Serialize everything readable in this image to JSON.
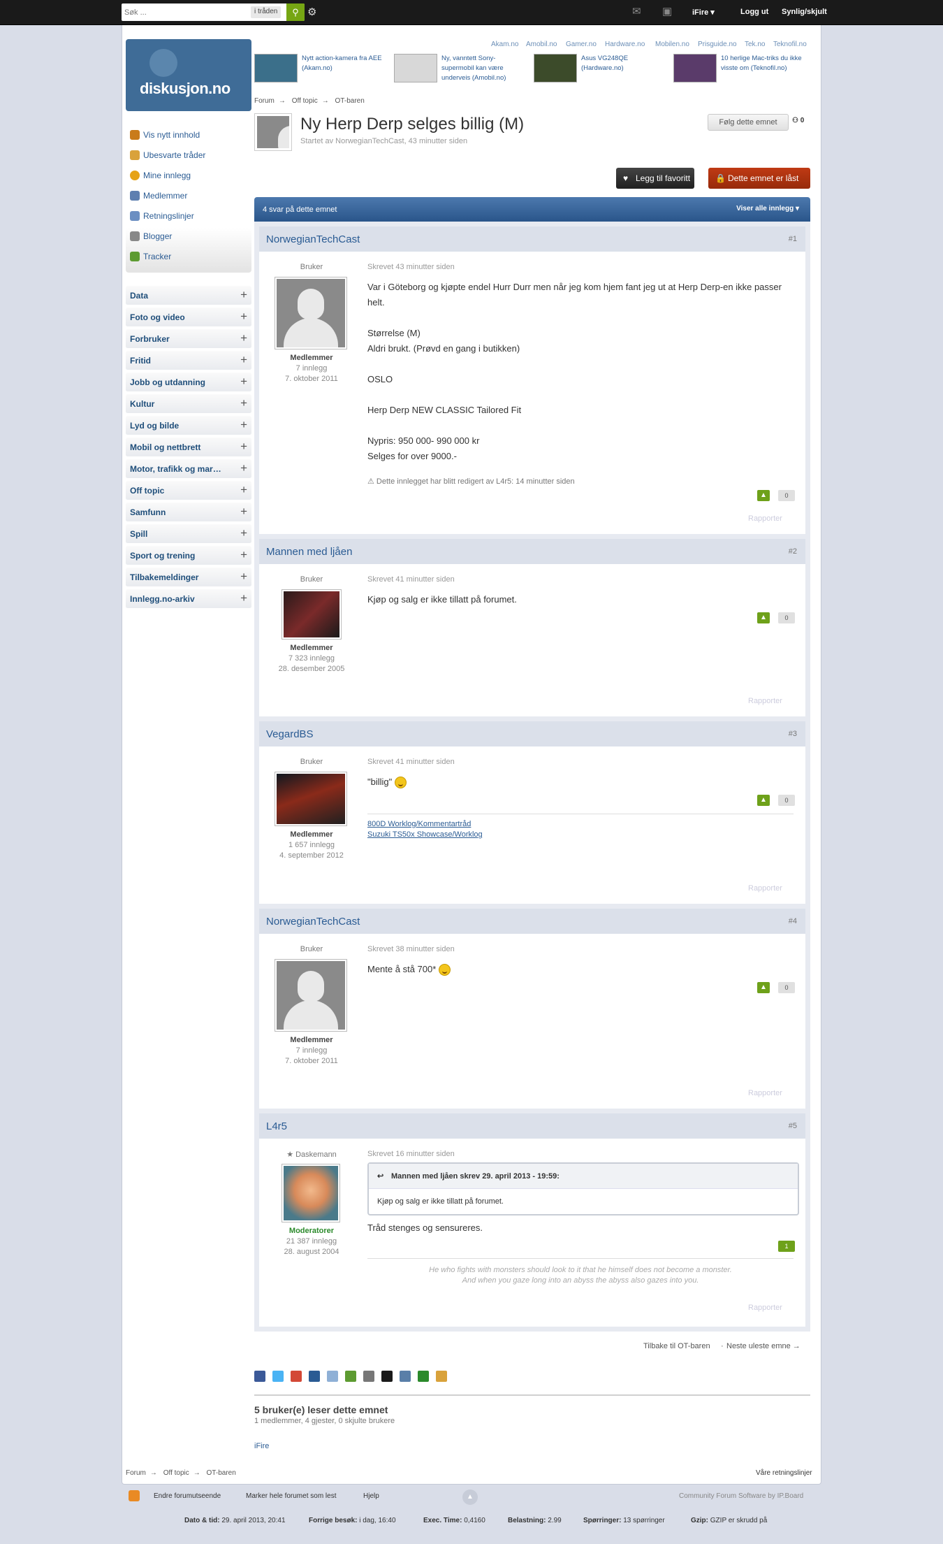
{
  "topbar": {
    "search_placeholder": "Søk ...",
    "search_scope": "i tråden",
    "user": "iFire",
    "logout": "Logg ut",
    "toggle": "Synlig/skjult"
  },
  "logo": {
    "text": "diskusjon.no"
  },
  "quicknav": [
    {
      "label": "Vis nytt innhold",
      "color": "#c97b1a"
    },
    {
      "label": "Ubesvarte tråder",
      "color": "#d9a23b"
    },
    {
      "label": "Mine innlegg",
      "color": "#e6a317"
    },
    {
      "label": "Medlemmer",
      "color": "#5e7fb0"
    },
    {
      "label": "Retningslinjer",
      "color": "#6c8fc2"
    },
    {
      "label": "Blogger",
      "color": "#888888"
    },
    {
      "label": "Tracker",
      "color": "#5d9b31"
    }
  ],
  "categories": [
    "Data",
    "Foto og video",
    "Forbruker",
    "Fritid",
    "Jobb og utdanning",
    "Kultur",
    "Lyd og bilde",
    "Mobil og nettbrett",
    "Motor, trafikk og mar…",
    "Off topic",
    "Samfunn",
    "Spill",
    "Sport og trening",
    "Tilbakemeldinger",
    "Innlegg.no-arkiv"
  ],
  "sites": [
    "Akam.no",
    "Amobil.no",
    "Gamer.no",
    "Hardware.no",
    "Mobilen.no",
    "Prisguide.no",
    "Tek.no",
    "Teknofil.no"
  ],
  "ads": [
    {
      "text": "Nytt action-kamera fra AEE (Akam.no)",
      "color": "#3b6f8a"
    },
    {
      "text": "Ny, vanntett Sony-supermobil kan være underveis (Amobil.no)",
      "color": "#d8d8d8"
    },
    {
      "text": "Asus VG248QE (Hardware.no)",
      "color": "#3c4b2a"
    },
    {
      "text": "10 herlige Mac-triks du ikke visste om (Teknofil.no)",
      "color": "#5a3b6a"
    }
  ],
  "breadcrumb": [
    "Forum",
    "Off topic",
    "OT-baren"
  ],
  "topic": {
    "title": "Ny Herp Derp selges billig (M)",
    "starter": "Startet av NorwegianTechCast, 43 minutter siden",
    "follow": "Følg dette emnet",
    "follow_count": "0",
    "favorite": "Legg til favoritt",
    "locked": "Dette emnet er låst",
    "replies": "4 svar på dette emnet",
    "show_all": "Viser alle innlegg"
  },
  "posts": [
    {
      "author": "NorwegianTechCast",
      "num": "#1",
      "title": "Bruker",
      "group": "Medlemmer",
      "posts_count": "7 innlegg",
      "joined": "7. oktober 2011",
      "date": "Skrevet 43 minutter siden",
      "body": [
        "Var i Göteborg og kjøpte endel Hurr Durr men når jeg kom hjem fant jeg ut at Herp Derp-en ikke passer helt.",
        "",
        "Størrelse (M)",
        "Aldri brukt. (Prøvd en gang i butikken)",
        "",
        "OSLO",
        "",
        "Herp Derp NEW CLASSIC Tailored Fit",
        "",
        "Nypris: 950 000- 990 000 kr",
        "Selges for over 9000.-"
      ],
      "edited": "Dette innlegget har blitt redigert av L4r5: 14 minutter siden",
      "votes": "0",
      "report": "Rapporter"
    },
    {
      "author": "Mannen med ljåen",
      "num": "#2",
      "title": "Bruker",
      "group": "Medlemmer",
      "posts_count": "7 323 innlegg",
      "joined": "28. desember 2005",
      "date": "Skrevet 41 minutter siden",
      "body": [
        "Kjøp og salg er ikke tillatt på forumet."
      ],
      "votes": "0",
      "report": "Rapporter"
    },
    {
      "author": "VegardBS",
      "num": "#3",
      "title": "Bruker",
      "group": "Medlemmer",
      "posts_count": "1 657 innlegg",
      "joined": "4. september 2012",
      "date": "Skrevet 41 minutter siden",
      "body": [
        "\"billig\""
      ],
      "sig": [
        "800D Worklog/Kommentartråd",
        "Suzuki TS50x Showcase/Worklog"
      ],
      "votes": "0",
      "report": "Rapporter"
    },
    {
      "author": "NorwegianTechCast",
      "num": "#4",
      "title": "Bruker",
      "group": "Medlemmer",
      "posts_count": "7 innlegg",
      "joined": "7. oktober 2011",
      "date": "Skrevet 38 minutter siden",
      "body": [
        "Mente å stå 700*"
      ],
      "votes": "0",
      "report": "Rapporter"
    },
    {
      "author": "L4r5",
      "num": "#5",
      "title": "★ Daskemann",
      "group": "Moderatorer",
      "posts_count": "21 387 innlegg",
      "joined": "28. august 2004",
      "date": "Skrevet 16 minutter siden",
      "quote_head": "Mannen med ljåen skrev 29. april 2013 - 19:59:",
      "quote_body": "Kjøp og salg er ikke tillatt på forumet.",
      "body": [
        "Tråd stenges og sensureres."
      ],
      "sig_quote": [
        "He who fights with monsters should look to it that he himself does not become a monster.",
        "And when you gaze long into an abyss the abyss also gazes into you."
      ],
      "votes": "1",
      "report": "Rapporter"
    }
  ],
  "bottom": {
    "back": "Tilbake til OT-baren",
    "next": "Neste uleste emne →",
    "readers_title": "5 bruker(e) leser dette emnet",
    "readers_sub": "1 medlemmer, 4 gjester, 0 skjulte brukere",
    "reader": "iFire",
    "guidelines": "Våre retningslinjer"
  },
  "footer": {
    "theme": "Endre forumutseende",
    "mark_read": "Marker hele forumet som lest",
    "help": "Hjelp",
    "powered": "Community Forum Software by IP.Board",
    "stats": [
      {
        "k": "Dato & tid:",
        "v": "29. april 2013, 20:41"
      },
      {
        "k": "Forrige besøk:",
        "v": "i dag, 16:40"
      },
      {
        "k": "Exec. Time:",
        "v": "0,4160"
      },
      {
        "k": "Belastning:",
        "v": "2.99"
      },
      {
        "k": "Spørringer:",
        "v": "13 spørringer"
      },
      {
        "k": "Gzip:",
        "v": "GZIP er skrudd på"
      }
    ]
  }
}
